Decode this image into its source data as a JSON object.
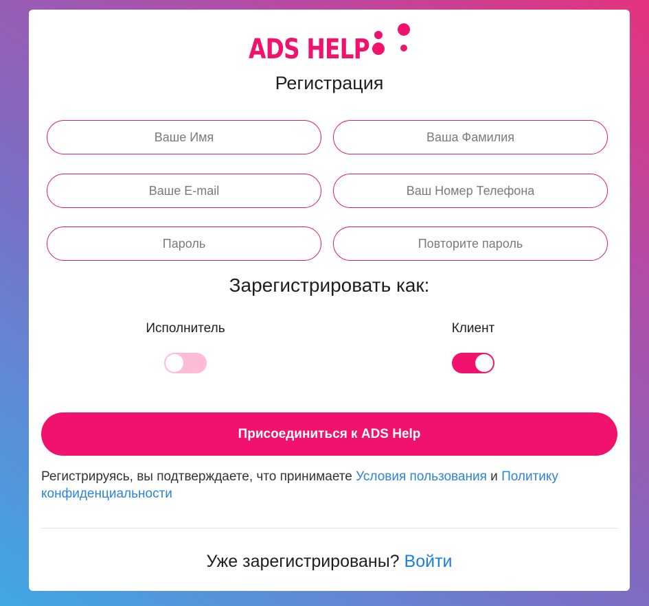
{
  "logo": {
    "text": "ADS HELP"
  },
  "title": "Регистрация",
  "fields": {
    "first_name": {
      "placeholder": "Ваше Имя",
      "value": ""
    },
    "last_name": {
      "placeholder": "Ваша Фамилия",
      "value": ""
    },
    "email": {
      "placeholder": "Ваше E-mail",
      "value": ""
    },
    "phone": {
      "placeholder": "Ваш Номер Телефона",
      "value": ""
    },
    "password": {
      "placeholder": "Пароль",
      "value": ""
    },
    "password_repeat": {
      "placeholder": "Повторите пароль",
      "value": ""
    }
  },
  "register_as": {
    "heading": "Зарегистрировать как:",
    "executor": {
      "label": "Исполнитель",
      "on": false
    },
    "client": {
      "label": "Клиент",
      "on": true
    }
  },
  "join_button": "Присоединиться к ADS Help",
  "terms": {
    "prefix": "Регистрируясь, вы подтверждаете, что принимаете ",
    "terms_link": "Условия пользования",
    "and": " и ",
    "privacy_link": "Политику конфиденциальности"
  },
  "login": {
    "question": "Уже зарегистрированы? ",
    "link": "Войти"
  },
  "colors": {
    "accent": "#f0126d",
    "toggle_off": "#ffbcd8",
    "link": "#2d83d9"
  }
}
